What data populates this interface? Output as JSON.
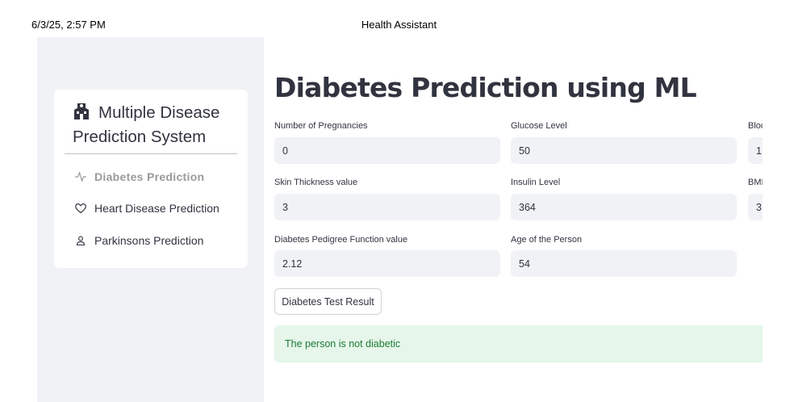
{
  "print_header": {
    "datetime": "6/3/25, 2:57 PM",
    "title": "Health Assistant"
  },
  "sidebar": {
    "menu_title": "Multiple Disease Prediction System",
    "menu_icon": "hospital-icon",
    "items": [
      {
        "label": "Diabetes Prediction",
        "icon": "activity-icon",
        "active": true
      },
      {
        "label": "Heart Disease Prediction",
        "icon": "heart-icon",
        "active": false
      },
      {
        "label": "Parkinsons Prediction",
        "icon": "person-icon",
        "active": false
      }
    ]
  },
  "main": {
    "title": "Diabetes Prediction using ML",
    "fields": {
      "pregnancies": {
        "label": "Number of Pregnancies",
        "value": "0"
      },
      "glucose": {
        "label": "Glucose Level",
        "value": "50"
      },
      "blood_pressure": {
        "label": "Blood Pressure value",
        "value": "1"
      },
      "skin_thickness": {
        "label": "Skin Thickness value",
        "value": "3"
      },
      "insulin": {
        "label": "Insulin Level",
        "value": "364"
      },
      "bmi": {
        "label": "BMI value",
        "value": "3"
      },
      "pedigree": {
        "label": "Diabetes Pedigree Function value",
        "value": "2.12"
      },
      "age": {
        "label": "Age of the Person",
        "value": "54"
      }
    },
    "button_label": "Diabetes Test Result",
    "result_text": "The person is not diabetic"
  },
  "colors": {
    "sidebar_bg": "#f0f2f6",
    "input_bg": "#f0f2f6",
    "success_bg": "#e6f6ea",
    "success_text": "#1d7a35",
    "text": "#31333f"
  }
}
